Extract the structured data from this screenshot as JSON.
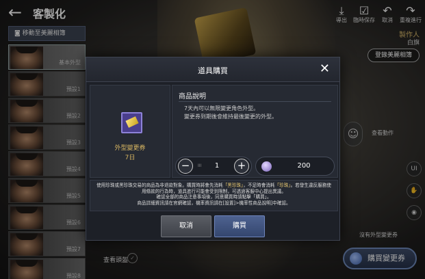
{
  "topbar": {
    "title": "客製化",
    "tools": [
      {
        "icon": "download-icon",
        "label": "導出"
      },
      {
        "icon": "save-draft-icon",
        "label": "臨時保存"
      },
      {
        "icon": "undo-icon",
        "label": "取消"
      },
      {
        "icon": "redo-icon",
        "label": "重複進行"
      }
    ]
  },
  "producer": {
    "label": "製作人",
    "name": "白旗"
  },
  "register_album_label": "登錄美麗相簿",
  "move_album_label": "移動至美麗相簿",
  "presets": [
    {
      "label": "基本外型"
    },
    {
      "label": "預設1"
    },
    {
      "label": "預設2"
    },
    {
      "label": "預設3"
    },
    {
      "label": "預設4"
    },
    {
      "label": "預設5"
    },
    {
      "label": "預設6"
    },
    {
      "label": "預設7"
    },
    {
      "label": "預設8"
    }
  ],
  "view_eye_label": "查看頭盔",
  "action_label": "查看動作",
  "right_buttons": {
    "ui_label": "UI"
  },
  "no_outfit_label": "沒有外型變更券",
  "buy_change_label": "購買變更券",
  "dialog": {
    "title": "道具購買",
    "item_name": "外型變更券",
    "item_duration": "7日",
    "desc_title": "商品說明",
    "desc_line1": "7天內可以無限變更角色外型。",
    "desc_line2": "變更券到期後會維持最後變更的外型。",
    "qty_max_label": "III",
    "quantity": "1",
    "price": "200",
    "notice_line1a": "使用珍珠或黑珍珠交易的商品為非退款對象。購買時將會先消耗",
    "notice_line1b": "「黑珍珠」",
    "notice_line1c": "，不足時會消耗",
    "notice_line1d": "「珍珠」",
    "notice_line1e": "。若發生違反服務使",
    "notice_line2": "用條款的行為時，道具進行可能會受到限制，可透過客服中心提出異議。",
    "notice_line3": "確認全部的商品注意事項後，同意購買時請點擊「購買」。",
    "notice_line4": "商品詳細資訊請在官網確認，機率資訊請在[設置]>機率性商品說明]中確認。",
    "cancel_label": "取消",
    "buy_label": "購買"
  }
}
